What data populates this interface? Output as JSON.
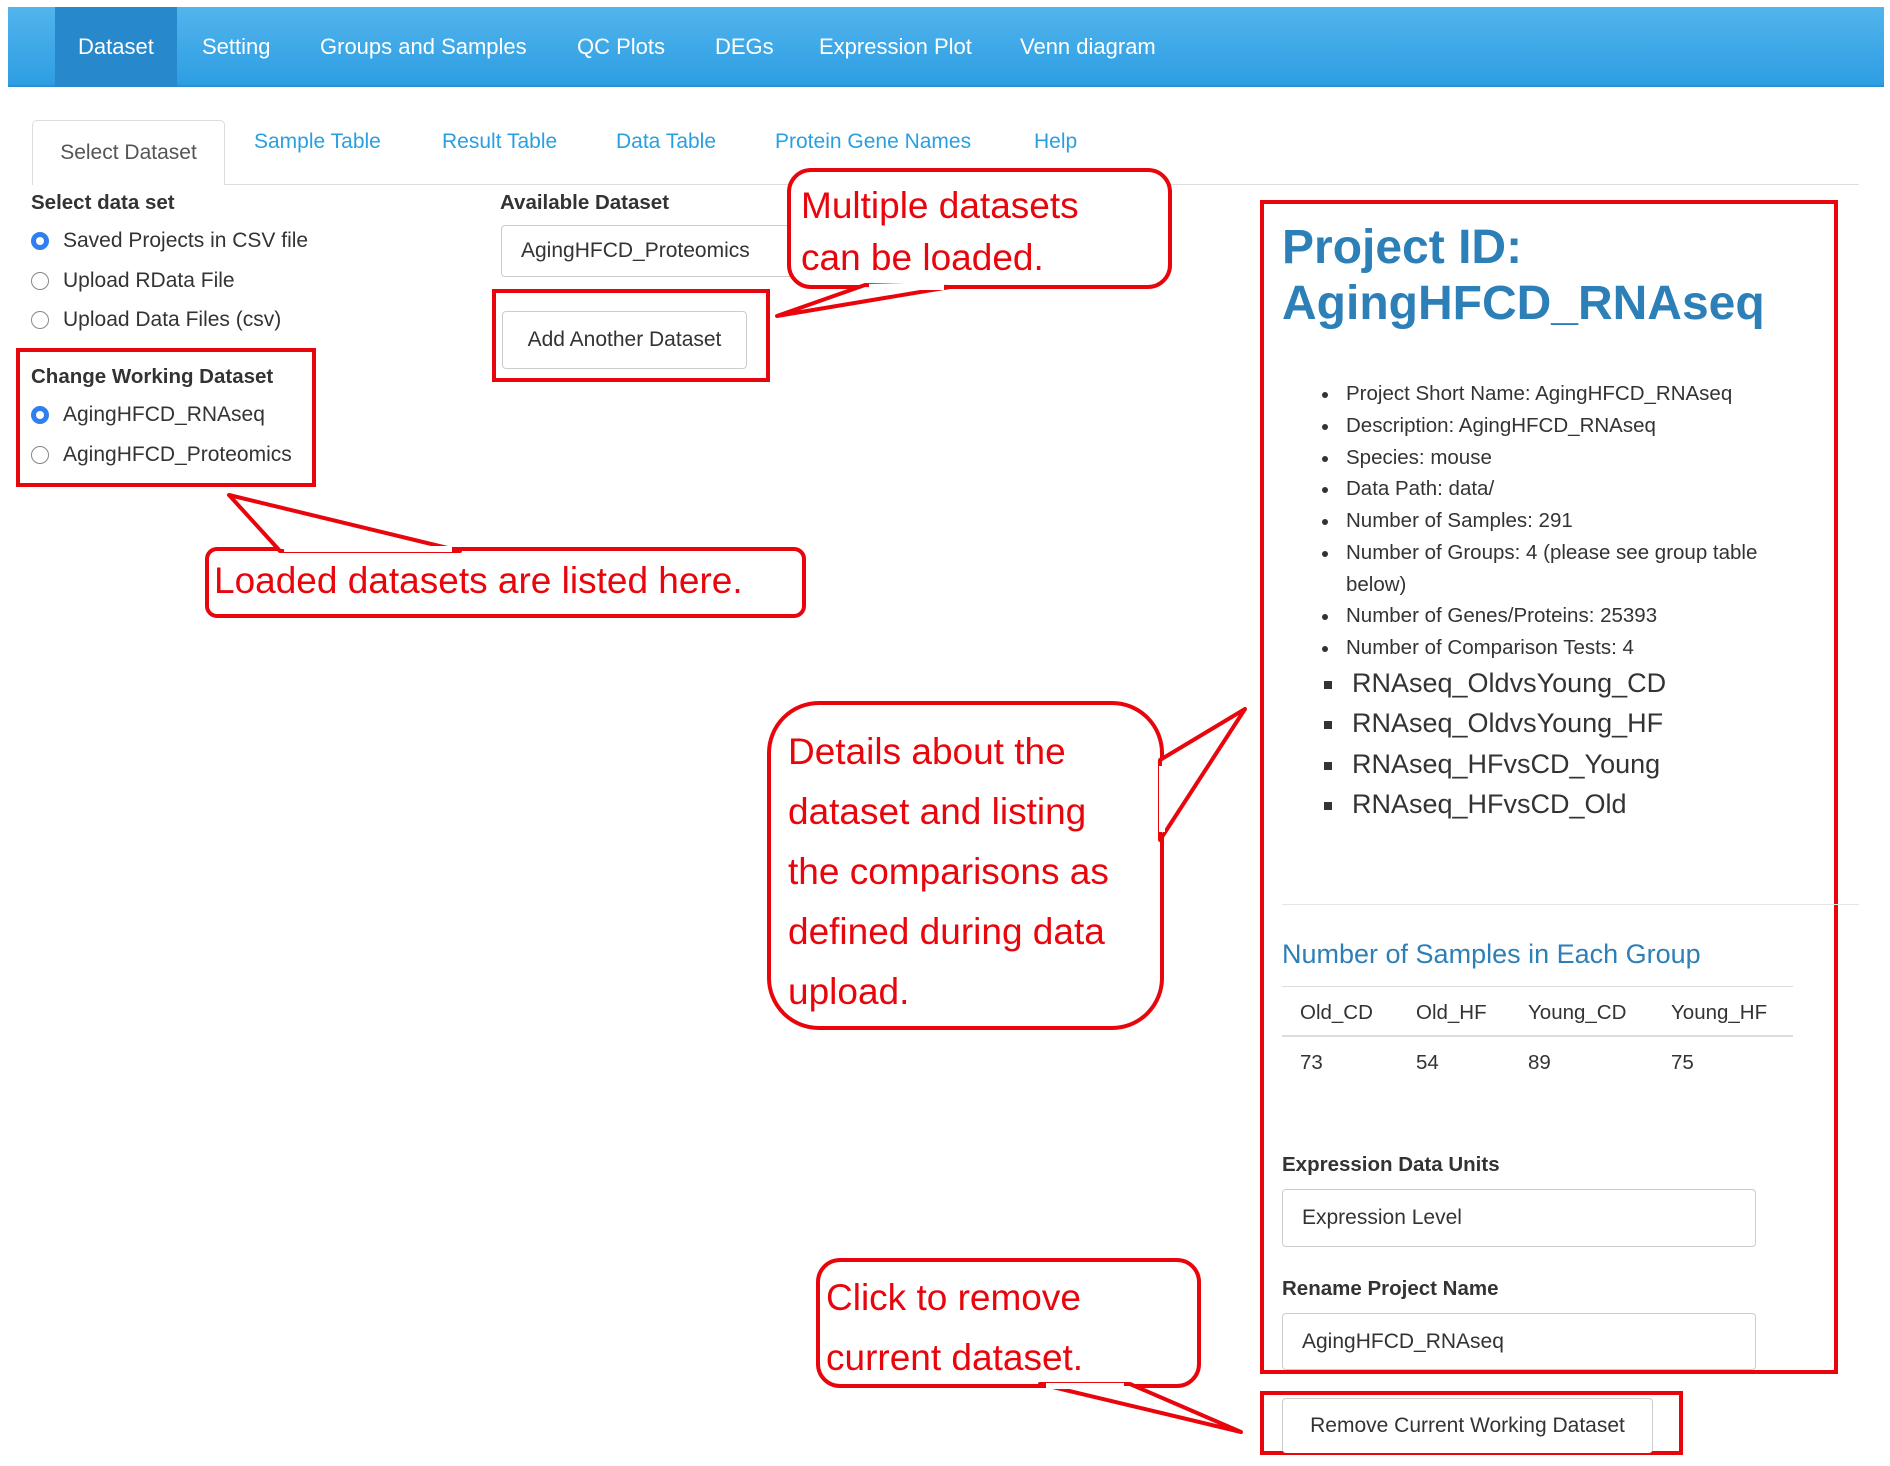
{
  "navbar": {
    "items": [
      "Dataset",
      "Setting",
      "Groups and Samples",
      "QC Plots",
      "DEGs",
      "Expression Plot",
      "Venn diagram"
    ],
    "active": "Dataset"
  },
  "tabs": [
    "Select Dataset",
    "Sample Table",
    "Result Table",
    "Data Table",
    "Protein Gene Names",
    "Help"
  ],
  "select_data_set": {
    "label": "Select data set",
    "options": [
      "Saved Projects in CSV file",
      "Upload RData File",
      "Upload Data Files (csv)"
    ],
    "selected": "Saved Projects in CSV file"
  },
  "change_working": {
    "label": "Change Working Dataset",
    "options": [
      "AgingHFCD_RNAseq",
      "AgingHFCD_Proteomics"
    ],
    "selected": "AgingHFCD_RNAseq"
  },
  "available": {
    "label": "Available Dataset",
    "value": "AgingHFCD_Proteomics",
    "add_button": "Add Another Dataset"
  },
  "project": {
    "title_line1": "Project ID:",
    "title_line2": "AgingHFCD_RNAseq",
    "details": [
      "Project Short Name: AgingHFCD_RNAseq",
      "Description: AgingHFCD_RNAseq",
      "Species: mouse",
      "Data Path: data/",
      "Number of Samples: 291",
      "Number of Groups: 4 (please see group table",
      "below)",
      "Number of Genes/Proteins: 25393",
      "Number of Comparison Tests: 4"
    ],
    "comparisons": [
      "RNAseq_OldvsYoung_CD",
      "RNAseq_OldvsYoung_HF",
      "RNAseq_HFvsCD_Young",
      "RNAseq_HFvsCD_Old"
    ]
  },
  "group_table": {
    "title": "Number of Samples in Each Group",
    "headers": [
      "Old_CD",
      "Old_HF",
      "Young_CD",
      "Young_HF"
    ],
    "values": [
      "73",
      "54",
      "89",
      "75"
    ]
  },
  "units": {
    "label": "Expression Data Units",
    "value": "Expression Level"
  },
  "rename": {
    "label": "Rename Project Name",
    "value": "AgingHFCD_RNAseq"
  },
  "remove_button": "Remove Current Working Dataset",
  "callouts": {
    "multiple": [
      "Multiple datasets",
      "can be loaded."
    ],
    "loaded": "Loaded datasets are listed here.",
    "details": [
      "Details about the",
      "dataset and listing",
      "the comparisons as",
      "defined during data",
      "upload."
    ],
    "remove": [
      "Click to remove",
      "current dataset."
    ]
  },
  "colors": {
    "annotation": "#e8050c",
    "nav": "#2d9ee3",
    "link": "#2a9fe0",
    "title": "#2d7fb8"
  }
}
